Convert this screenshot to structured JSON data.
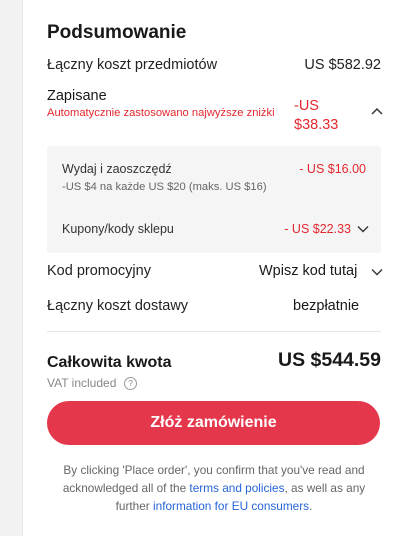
{
  "summary": {
    "title": "Podsumowanie",
    "items_cost": {
      "label": "Łączny koszt przedmiotów",
      "value": "US $582.92"
    },
    "saved": {
      "label": "Zapisane",
      "note": "Automatycznie zastosowano najwyższe zniżki",
      "value_line1": "-US",
      "value_line2": "$38.33"
    },
    "discounts": [
      {
        "label": "Wydaj i zaoszczędź",
        "sub": "-US $4 na każde US $20 (maks. US $16)",
        "value": "- US $16.00"
      },
      {
        "label": "Kupony/kody sklepu",
        "value": "- US $22.33"
      }
    ],
    "promo": {
      "label": "Kod promocyjny",
      "action": "Wpisz kod tutaj"
    },
    "shipping": {
      "label": "Łączny koszt dostawy",
      "value": "bezpłatnie"
    },
    "total": {
      "label": "Całkowita kwota",
      "value": "US $544.59",
      "vat": "VAT included"
    },
    "place_order": "Złóż zamówienie",
    "legal": {
      "part1": "By clicking 'Place order', you confirm that you've read and acknowledged all of the ",
      "link1": "terms and policies",
      "part2": ", as well as any further ",
      "link2": "information for EU consumers",
      "part3": "."
    }
  },
  "colors": {
    "accent_red": "#e2282e",
    "button": "#e5374b",
    "link": "#2865d8"
  },
  "icons": [
    "chevron-up-icon",
    "chevron-down-icon",
    "question-icon"
  ]
}
